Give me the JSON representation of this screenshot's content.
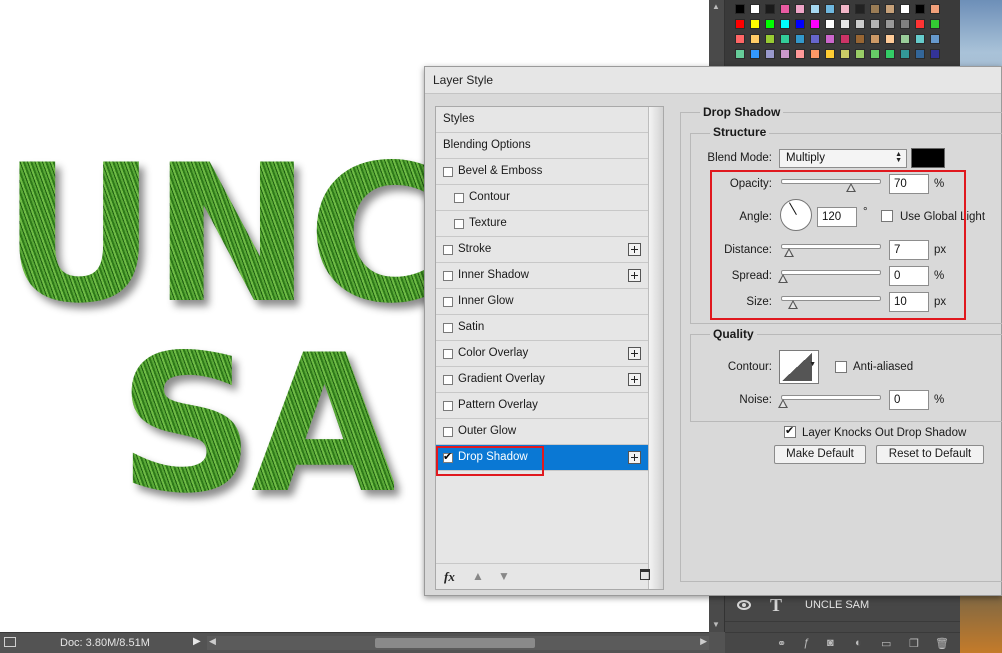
{
  "canvas": {
    "line1": "UNC",
    "line2": "SA"
  },
  "status": {
    "doc": "Doc: 3.80M/8.51M"
  },
  "dialog": {
    "title": "Layer Style",
    "styles": [
      {
        "label": "Styles",
        "checkbox": false,
        "plus": false,
        "indent": false,
        "selected": false
      },
      {
        "label": "Blending Options",
        "checkbox": false,
        "plus": false,
        "indent": false,
        "selected": false
      },
      {
        "label": "Bevel & Emboss",
        "checkbox": true,
        "checked": false,
        "plus": false,
        "indent": false,
        "selected": false
      },
      {
        "label": "Contour",
        "checkbox": true,
        "checked": false,
        "plus": false,
        "indent": true,
        "selected": false
      },
      {
        "label": "Texture",
        "checkbox": true,
        "checked": false,
        "plus": false,
        "indent": true,
        "selected": false
      },
      {
        "label": "Stroke",
        "checkbox": true,
        "checked": false,
        "plus": true,
        "indent": false,
        "selected": false
      },
      {
        "label": "Inner Shadow",
        "checkbox": true,
        "checked": false,
        "plus": true,
        "indent": false,
        "selected": false
      },
      {
        "label": "Inner Glow",
        "checkbox": true,
        "checked": false,
        "plus": false,
        "indent": false,
        "selected": false
      },
      {
        "label": "Satin",
        "checkbox": true,
        "checked": false,
        "plus": false,
        "indent": false,
        "selected": false
      },
      {
        "label": "Color Overlay",
        "checkbox": true,
        "checked": false,
        "plus": true,
        "indent": false,
        "selected": false
      },
      {
        "label": "Gradient Overlay",
        "checkbox": true,
        "checked": false,
        "plus": true,
        "indent": false,
        "selected": false
      },
      {
        "label": "Pattern Overlay",
        "checkbox": true,
        "checked": false,
        "plus": false,
        "indent": false,
        "selected": false
      },
      {
        "label": "Outer Glow",
        "checkbox": true,
        "checked": false,
        "plus": false,
        "indent": false,
        "selected": false
      },
      {
        "label": "Drop Shadow",
        "checkbox": true,
        "checked": true,
        "plus": true,
        "indent": false,
        "selected": true
      }
    ],
    "footer": {
      "fx": "fx"
    },
    "settings": {
      "section_title": "Drop Shadow",
      "structure_title": "Structure",
      "blend_mode_label": "Blend Mode:",
      "blend_mode_value": "Multiply",
      "shadow_color": "#000000",
      "opacity_label": "Opacity:",
      "opacity_value": "70",
      "opacity_unit": "%",
      "angle_label": "Angle:",
      "angle_value": "120",
      "angle_unit": "°",
      "use_global_light_label": "Use Global Light",
      "distance_label": "Distance:",
      "distance_value": "7",
      "distance_unit": "px",
      "spread_label": "Spread:",
      "spread_value": "0",
      "spread_unit": "%",
      "size_label": "Size:",
      "size_value": "10",
      "size_unit": "px",
      "quality_title": "Quality",
      "contour_label": "Contour:",
      "anti_aliased_label": "Anti-aliased",
      "noise_label": "Noise:",
      "noise_value": "0",
      "noise_unit": "%",
      "knockout_label": "Layer Knocks Out Drop Shadow",
      "make_default_label": "Make Default",
      "reset_default_label": "Reset to Default"
    }
  },
  "layers": {
    "layer_name": "UNCLE SAM"
  },
  "colors": {
    "selection_blue": "#0a78d4",
    "highlight_red": "#e0181e",
    "grass_green": "#3d8a23"
  }
}
